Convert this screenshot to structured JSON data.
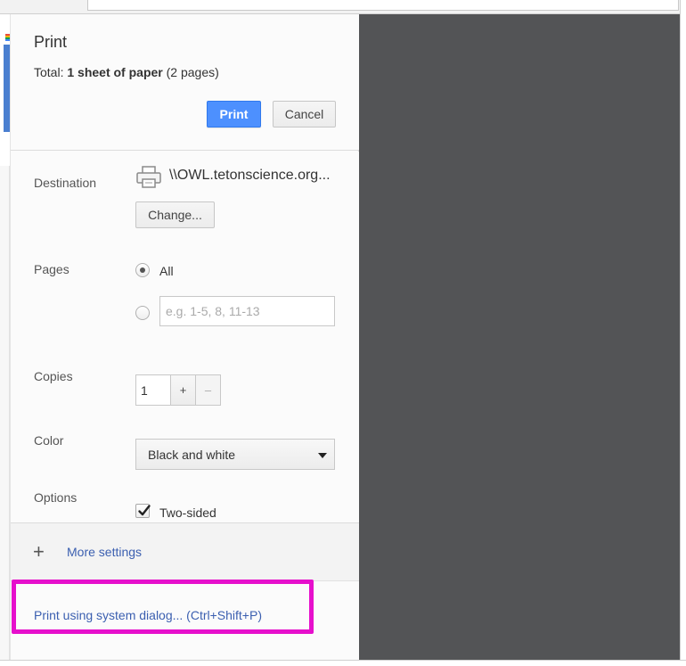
{
  "dialog": {
    "title": "Print",
    "summary_prefix": "Total: ",
    "summary_bold": "1 sheet of paper",
    "summary_suffix": " (2 pages)",
    "print_button": "Print",
    "cancel_button": "Cancel"
  },
  "destination": {
    "label": "Destination",
    "icon": "printer-icon",
    "name": "\\\\OWL.tetonscience.org...",
    "change_button": "Change..."
  },
  "pages": {
    "label": "Pages",
    "all_label": "All",
    "selected": "all",
    "custom_placeholder": "e.g. 1-5, 8, 11-13"
  },
  "copies": {
    "label": "Copies",
    "value": "1",
    "increment": "+",
    "decrement": "–"
  },
  "color": {
    "label": "Color",
    "selected": "Black and white"
  },
  "options": {
    "label": "Options",
    "two_sided_label": "Two-sided",
    "two_sided_checked": true
  },
  "more_settings": {
    "icon": "plus-icon",
    "label": "More settings"
  },
  "system_dialog": {
    "label": "Print using system dialog... (Ctrl+Shift+P)"
  },
  "colors": {
    "accent_blue": "#4d90fe",
    "link_blue": "#3b5fb0",
    "highlight_magenta": "#e60fcc",
    "preview_bg": "#535456"
  }
}
